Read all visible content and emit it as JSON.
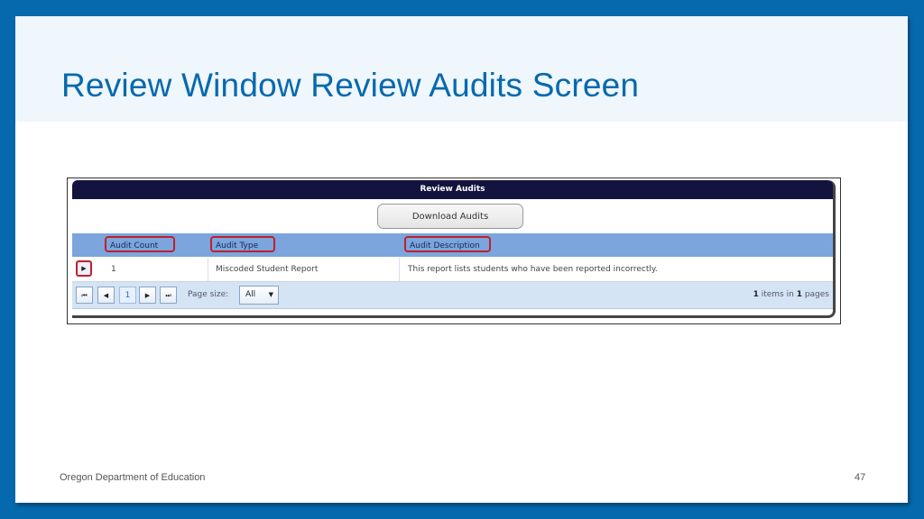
{
  "slide": {
    "title": "Review Window Review Audits Screen",
    "footer_left": "Oregon Department of Education",
    "page_number": "47"
  },
  "colors": {
    "frame": "#0669ad",
    "title": "#0669ad",
    "panel_header": "#14133f",
    "table_header": "#7ba5dc",
    "highlight": "#c0202a"
  },
  "screenshot": {
    "panel_title": "Review Audits",
    "download_button": "Download Audits",
    "columns": [
      "Audit Count",
      "Audit Type",
      "Audit Description"
    ],
    "rows": [
      {
        "expand_icon": "triangle-right-icon",
        "audit_count": "1",
        "audit_type": "Miscoded Student Report",
        "audit_description": "This report lists students who have been reported incorrectly."
      }
    ],
    "pager": {
      "first_icon": "⏮",
      "prev_icon": "◀",
      "current_page": "1",
      "next_icon": "▶",
      "last_icon": "⏭",
      "page_size_label": "Page size:",
      "page_size_value": "All",
      "items_count": "1",
      "items_text": "items in",
      "pages_count": "1",
      "pages_text": "pages"
    }
  }
}
